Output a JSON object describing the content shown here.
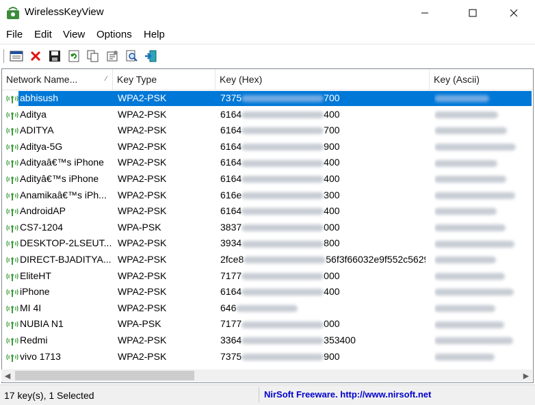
{
  "window": {
    "title": "WirelessKeyView"
  },
  "menu": [
    "File",
    "Edit",
    "View",
    "Options",
    "Help"
  ],
  "toolbar": [
    {
      "name": "html-report-icon"
    },
    {
      "name": "delete-icon"
    },
    {
      "name": "save-icon"
    },
    {
      "name": "refresh-icon"
    },
    {
      "name": "copy-icon"
    },
    {
      "name": "properties-icon"
    },
    {
      "name": "find-icon"
    },
    {
      "name": "exit-icon"
    }
  ],
  "columns": {
    "name": "Network Name...",
    "type": "Key Type",
    "hex": "Key (Hex)",
    "ascii": "Key (Ascii)"
  },
  "rows": [
    {
      "name": "abhisush",
      "type": "WPA2-PSK",
      "hex_start": "7375",
      "hex_end": "700",
      "selected": true
    },
    {
      "name": "Aditya",
      "type": "WPA2-PSK",
      "hex_start": "6164",
      "hex_end": "400"
    },
    {
      "name": "ADITYA",
      "type": "WPA2-PSK",
      "hex_start": "6164",
      "hex_end": "700"
    },
    {
      "name": "Aditya-5G",
      "type": "WPA2-PSK",
      "hex_start": "6164",
      "hex_end": "900"
    },
    {
      "name": "Adityaâ€™s iPhone",
      "type": "WPA2-PSK",
      "hex_start": "6164",
      "hex_end": "400"
    },
    {
      "name": "Adityâ€™s iPhone",
      "type": "WPA2-PSK",
      "hex_start": "6164",
      "hex_end": "400"
    },
    {
      "name": "Anamikaâ€™s iPh...",
      "type": "WPA2-PSK",
      "hex_start": "616e",
      "hex_end": "300"
    },
    {
      "name": "AndroidAP",
      "type": "WPA2-PSK",
      "hex_start": "6164",
      "hex_end": "400"
    },
    {
      "name": "CS7-1204",
      "type": "WPA-PSK",
      "hex_start": "3837",
      "hex_end": "000"
    },
    {
      "name": "DESKTOP-2LSEUT...",
      "type": "WPA2-PSK",
      "hex_start": "3934",
      "hex_end": "800"
    },
    {
      "name": "DIRECT-BJADITYA...",
      "type": "WPA2-PSK",
      "hex_start": "2fce8",
      "hex_end": "56f3f66032e9f552c5629..."
    },
    {
      "name": "EliteHT",
      "type": "WPA2-PSK",
      "hex_start": "7177",
      "hex_end": "000"
    },
    {
      "name": "iPhone",
      "type": "WPA2-PSK",
      "hex_start": "6164",
      "hex_end": "400"
    },
    {
      "name": "MI 4I",
      "type": "WPA2-PSK",
      "hex_start": "646",
      "hex_end": ""
    },
    {
      "name": "NUBIA N1",
      "type": "WPA-PSK",
      "hex_start": "7177",
      "hex_end": "000"
    },
    {
      "name": "Redmi",
      "type": "WPA2-PSK",
      "hex_start": "3364",
      "hex_end": "353400"
    },
    {
      "name": "vivo 1713",
      "type": "WPA2-PSK",
      "hex_start": "7375",
      "hex_end": "900"
    }
  ],
  "status": {
    "count": "17 key(s), 1 Selected",
    "link": "NirSoft Freeware.  http://www.nirsoft.net"
  },
  "colors": {
    "selection": "#0078d7",
    "link": "#0000cc"
  }
}
